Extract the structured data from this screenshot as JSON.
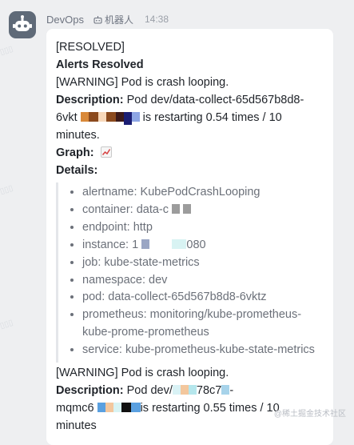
{
  "header": {
    "sender": "DevOps",
    "badge_label": "机器人",
    "time": "14:38"
  },
  "message": {
    "status_tag": "[RESOLVED]",
    "heading": "Alerts Resolved",
    "alert1": {
      "title": "[WARNING] Pod is crash looping.",
      "desc_label": "Description:",
      "desc_part1": "Pod dev/data-collect-65d567b8d8-",
      "desc_part2": "6vkt",
      "desc_part3": " is restarting 0.54 times / 10",
      "desc_part4": "minutes.",
      "graph_label": "Graph:",
      "details_label": "Details:",
      "details": [
        "alertname: KubePodCrashLooping",
        "container: data-c",
        "endpoint: http",
        "instance: 1",
        "job: kube-state-metrics",
        "namespace: dev",
        "pod: data-collect-65d567b8d8-6vktz",
        "prometheus: monitoring/kube-prometheus-",
        "kube-prome-prometheus",
        "service: kube-prometheus-kube-state-metrics"
      ],
      "instance_suffix": "080"
    },
    "alert2": {
      "title": "[WARNING] Pod is crash looping.",
      "desc_label": "Description:",
      "desc_part1": "Pod dev/",
      "desc_part1b": "78c7",
      "desc_part1c": "-",
      "desc_part2": "mqmc6",
      "desc_part3": "is restarting 0.55 times / 10",
      "desc_part4": "minutes"
    }
  },
  "footer_mark": "@稀土掘金技术社区",
  "colors": {
    "background": "#eeeff1",
    "bubble": "#ffffff",
    "avatar": "#5f6a78",
    "text": "#1f2329",
    "muted": "#6b7079"
  },
  "icons": {
    "avatar": "robot-icon",
    "badge": "robot-badge-icon",
    "graph": "chart-icon"
  }
}
